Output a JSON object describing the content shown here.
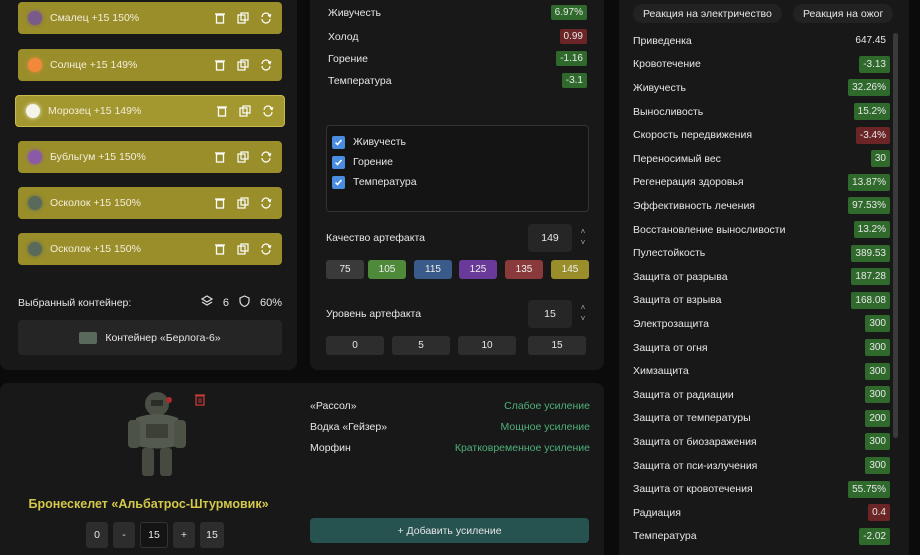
{
  "slots": [
    {
      "label": "Смалец +15 150%",
      "icon": "smalets-icon",
      "color": "#7a5a8a"
    },
    {
      "label": "Солнце +15 149%",
      "icon": "sun-icon",
      "color": "#f08a3a"
    },
    {
      "label": "Морозец +15 149%",
      "icon": "frost-icon",
      "color": "#f4f4e8"
    },
    {
      "label": "Бубльгум +15 150%",
      "icon": "bubblegum-icon",
      "color": "#8a5aa8"
    },
    {
      "label": "Осколок +15 150%",
      "icon": "shard-icon",
      "color": "#5a6a5a"
    },
    {
      "label": "Осколок +15 150%",
      "icon": "shard-icon",
      "color": "#5a6a5a"
    }
  ],
  "container": {
    "label": "Выбранный контейнер:",
    "slots_count": "6",
    "protection": "60%",
    "name": "Контейнер «Берлога-6»"
  },
  "artifact_stats": [
    {
      "name": "Живучесть",
      "value": "6.97%",
      "kind": "g"
    },
    {
      "name": "Холод",
      "value": "0.99",
      "kind": "r"
    },
    {
      "name": "Горение",
      "value": "-1.16",
      "kind": "g"
    },
    {
      "name": "Температура",
      "value": "-3.1",
      "kind": "g"
    }
  ],
  "checkboxes": [
    {
      "label": "Живучесть",
      "checked": true
    },
    {
      "label": "Горение",
      "checked": true
    },
    {
      "label": "Температура",
      "checked": true
    }
  ],
  "quality": {
    "label": "Качество артефакта",
    "value": "149",
    "presets": [
      {
        "v": "75",
        "c": "#3a3a3a"
      },
      {
        "v": "105",
        "c": "#4f8a3a"
      },
      {
        "v": "115",
        "c": "#3a5a8a"
      },
      {
        "v": "125",
        "c": "#6a3a9a"
      },
      {
        "v": "135",
        "c": "#8a3a3a"
      },
      {
        "v": "145",
        "c": "#9a8e2b"
      }
    ]
  },
  "level": {
    "label": "Уровень артефакта",
    "value": "15",
    "presets": [
      "0",
      "5",
      "10",
      "15"
    ]
  },
  "armor": {
    "name": "Бронескелет «Альбатрос-Штурмовик»",
    "controls": [
      "0",
      "-",
      "15",
      "+",
      "15"
    ]
  },
  "boosts": [
    {
      "name": "«Рассол»",
      "effect": "Слабое усиление"
    },
    {
      "name": "Водка «Гейзер»",
      "effect": "Мощное усиление"
    },
    {
      "name": "Морфин",
      "effect": "Кратковременное усиление"
    }
  ],
  "add_boost": "+ Добавить усиление",
  "tags": [
    "Реакция на электричество",
    "Реакция на ожог"
  ],
  "stats": [
    {
      "name": "Приведенка",
      "value": "647.45",
      "kind": ""
    },
    {
      "name": "Кровотечение",
      "value": "-3.13",
      "kind": "g"
    },
    {
      "name": "Живучесть",
      "value": "32.26%",
      "kind": "g"
    },
    {
      "name": "Выносливость",
      "value": "15.2%",
      "kind": "g"
    },
    {
      "name": "Скорость передвижения",
      "value": "-3.4%",
      "kind": "r"
    },
    {
      "name": "Переносимый вес",
      "value": "30",
      "kind": "g"
    },
    {
      "name": "Регенерация здоровья",
      "value": "13.87%",
      "kind": "g"
    },
    {
      "name": "Эффективность лечения",
      "value": "97.53%",
      "kind": "g"
    },
    {
      "name": "Восстановление выносливости",
      "value": "13.2%",
      "kind": "g"
    },
    {
      "name": "Пулестойкость",
      "value": "389.53",
      "kind": "g"
    },
    {
      "name": "Защита от разрыва",
      "value": "187.28",
      "kind": "g"
    },
    {
      "name": "Защита от взрыва",
      "value": "168.08",
      "kind": "g"
    },
    {
      "name": "Электрозащита",
      "value": "300",
      "kind": "g"
    },
    {
      "name": "Защита от огня",
      "value": "300",
      "kind": "g"
    },
    {
      "name": "Химзащита",
      "value": "300",
      "kind": "g"
    },
    {
      "name": "Защита от радиации",
      "value": "300",
      "kind": "g"
    },
    {
      "name": "Защита от температуры",
      "value": "200",
      "kind": "g"
    },
    {
      "name": "Защита от биозаражения",
      "value": "300",
      "kind": "g"
    },
    {
      "name": "Защита от пси-излучения",
      "value": "300",
      "kind": "g"
    },
    {
      "name": "Защита от кровотечения",
      "value": "55.75%",
      "kind": "g"
    },
    {
      "name": "Радиация",
      "value": "0.4",
      "kind": "r"
    },
    {
      "name": "Температура",
      "value": "-2.02",
      "kind": "g"
    }
  ]
}
